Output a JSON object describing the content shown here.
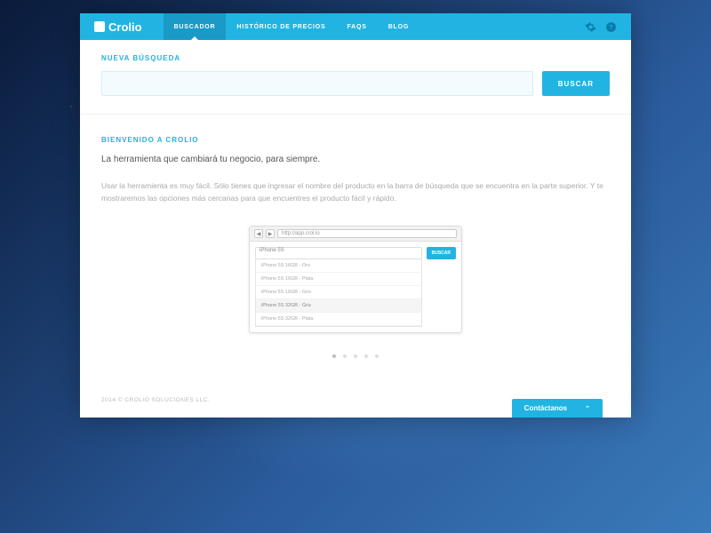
{
  "brand": "Crolio",
  "nav": {
    "items": [
      {
        "label": "BUSCADOR",
        "active": true
      },
      {
        "label": "HISTÓRICO DE PRECIOS",
        "active": false
      },
      {
        "label": "FAQS",
        "active": false
      },
      {
        "label": "BLOG",
        "active": false
      }
    ]
  },
  "search": {
    "label": "NUEVA BÚSQUEDA",
    "value": "",
    "button": "BUSCAR"
  },
  "welcome": {
    "title": "BIENVENIDO A CROLIO",
    "tagline": "La herramienta que cambiará tu negocio, para siempre.",
    "description": "Usar la herramienta es muy fácil. Sólo tienes que ingresar el nombre del producto en la barra de búsqueda que se encuentra en la parte superior. Y te mostraremos las opciones más cercanas para que encuentres el producto fácil y rápido."
  },
  "demo": {
    "url": "http://app.crol.io",
    "search_value": "iPhone 5S",
    "button": "BUSCAR",
    "options": [
      "iPhone 5S 16GB - Oro",
      "iPhone 5S 16GB - Plata",
      "iPhone 5S 16GB - Gris",
      "iPhone 5S 32GB - Gris",
      "iPhone 5S 32GB - Plata"
    ],
    "hover_index": 3
  },
  "carousel": {
    "count": 5,
    "active": 0
  },
  "footer": "2014 © CROLIO SOLUCIONES LLC.",
  "contact": "Contáctanos"
}
